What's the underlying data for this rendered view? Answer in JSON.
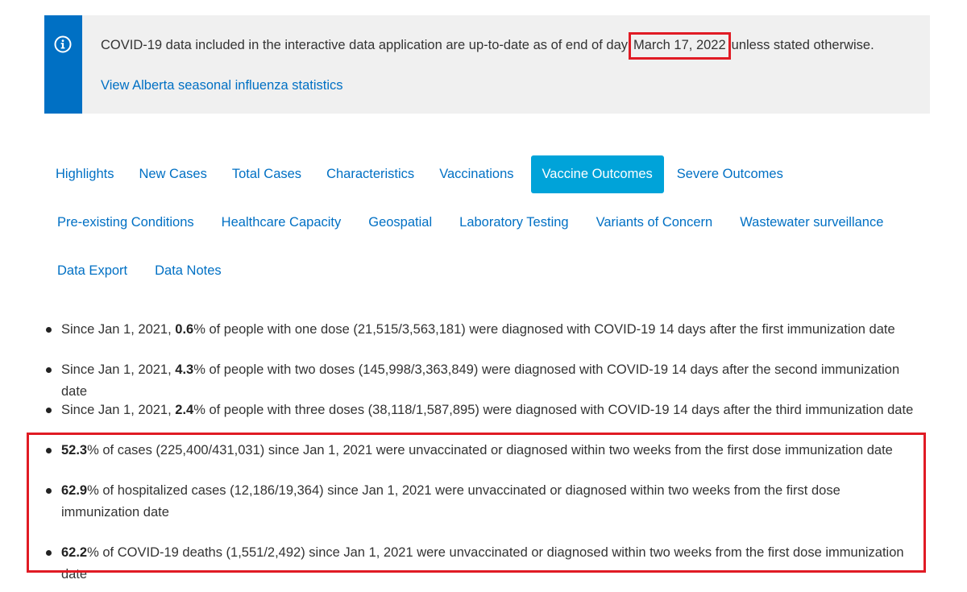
{
  "notice": {
    "text_before": "COVID-19 data included in the interactive data application are up-to-date as of end of day",
    "date": "March 17, 2022",
    "text_after": "unless stated otherwise.",
    "link": "View Alberta seasonal influenza statistics",
    "icon": "info-icon"
  },
  "tabs": {
    "row1": [
      "Highlights",
      "New Cases",
      "Total Cases",
      "Characteristics",
      "Vaccinations",
      "Vaccine Outcomes",
      "Severe Outcomes"
    ],
    "row2": [
      "Pre-existing Conditions",
      "Healthcare Capacity",
      "Geospatial",
      "Laboratory Testing",
      "Variants of Concern",
      "Wastewater surveillance"
    ],
    "row3": [
      "Data Export",
      "Data Notes"
    ],
    "active": "Vaccine Outcomes"
  },
  "bullets": [
    {
      "pre": "Since Jan 1, 2021, ",
      "bold": "0.6",
      "post": "% of people with one dose (21,515/3,563,181) were diagnosed with COVID-19 14 days after the first immunization date"
    },
    {
      "pre": "Since Jan 1, 2021, ",
      "bold": "4.3",
      "post": "% of people with two doses (145,998/3,363,849) were diagnosed with COVID-19 14 days after the second immunization date"
    },
    {
      "pre": "Since Jan 1, 2021, ",
      "bold": "2.4",
      "post": "% of people with three doses (38,118/1,587,895) were diagnosed with COVID-19 14 days after the third immunization date"
    },
    {
      "pre": "",
      "bold": "52.3",
      "post": "% of cases (225,400/431,031) since Jan 1, 2021 were unvaccinated or diagnosed within two weeks from the first dose immunization date"
    },
    {
      "pre": "",
      "bold": "62.9",
      "post": "% of hospitalized cases (12,186/19,364) since Jan 1, 2021 were unvaccinated or diagnosed within two weeks from the first dose immunization date"
    },
    {
      "pre": "",
      "bold": "62.2",
      "post": "% of COVID-19 deaths (1,551/2,492) since Jan 1, 2021 were unvaccinated or diagnosed within two weeks from the first dose immunization date"
    }
  ],
  "colors": {
    "accent": "#0070c4",
    "active_tab": "#00a3d9",
    "highlight_box": "#e01b24",
    "notice_bg": "#f0f0f0"
  }
}
